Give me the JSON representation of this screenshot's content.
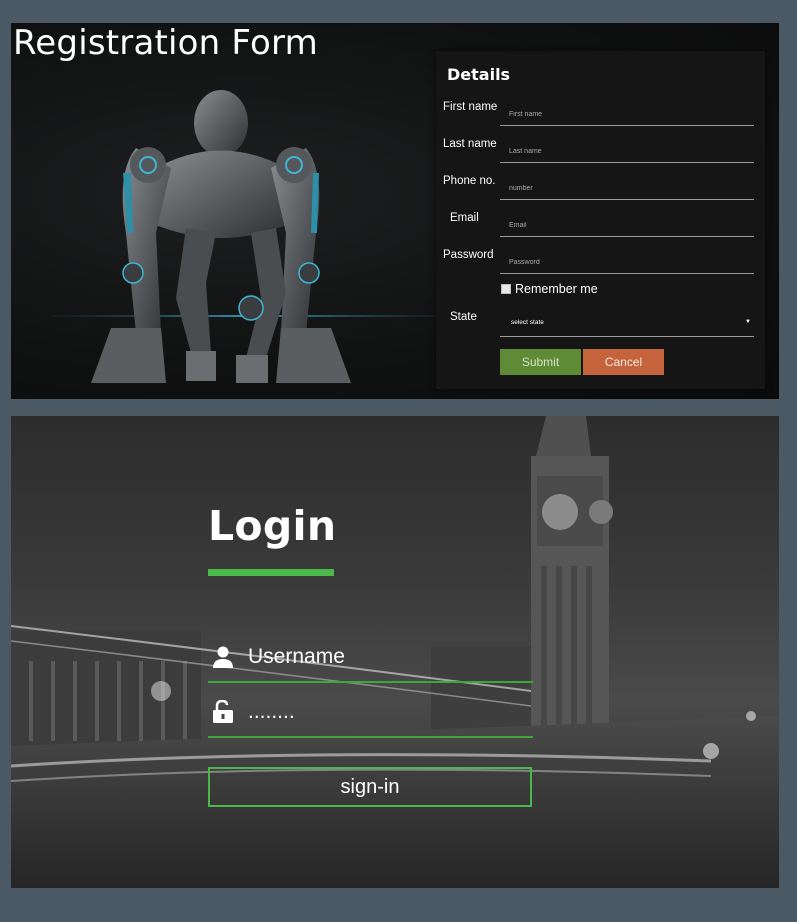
{
  "registration": {
    "title": "Registration Form",
    "heading": "Details",
    "fields": [
      {
        "label": "First name",
        "placeholder": "First name"
      },
      {
        "label": "Last name",
        "placeholder": "Last name"
      },
      {
        "label": "Phone no.",
        "placeholder": "number"
      },
      {
        "label": "Email",
        "placeholder": "Email"
      },
      {
        "label": "Password",
        "placeholder": "Password"
      }
    ],
    "remember_label": "Remember me",
    "state_label": "State",
    "state_selected": "select state",
    "submit_label": "Submit",
    "cancel_label": "Cancel",
    "colors": {
      "submit": "#5f8a36",
      "cancel": "#c4633c",
      "card": "#151515"
    }
  },
  "login": {
    "title": "Login",
    "username_placeholder": "Username",
    "password_value": "........",
    "signin_label": "sign-in",
    "icons": {
      "username": "user-icon",
      "password": "unlock-icon"
    },
    "colors": {
      "accent": "#4db84a"
    }
  }
}
